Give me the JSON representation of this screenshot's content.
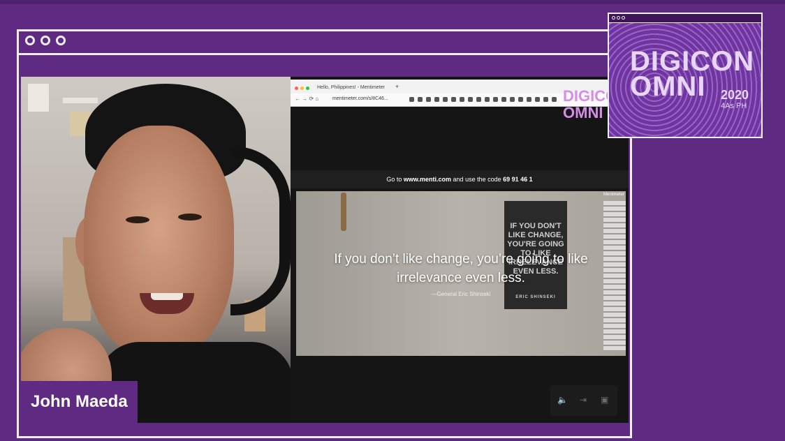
{
  "speaker": {
    "name": "John Maeda"
  },
  "browser": {
    "tab_title": "Hello, Philippines! - Mentimeter",
    "url": "mentimeter.com/s/8C46...",
    "new_tab": "+"
  },
  "menti": {
    "instruction_prefix": "Go to",
    "site": "www.menti.com",
    "instruction_mid": "and use the code",
    "code": "69 91 46 1",
    "logo": "Mentimeter"
  },
  "slide": {
    "quote_line1": "If you don’t like change, you’re going to like",
    "quote_line2": "irrelevance even less.",
    "author": "—General Eric Shinseki",
    "poster_text": "IF YOU DON'T LIKE CHANGE, YOU'RE GOING TO LIKE IRRELEVANCE EVEN LESS.",
    "poster_author": "ERIC SHINSEKI"
  },
  "event": {
    "line1": "DIGICON",
    "line2": "OMNI",
    "year": "2020",
    "org": "4As PH"
  },
  "icons": [
    "volume-icon",
    "exit-icon",
    "pip-icon"
  ],
  "colors": {
    "brand_purple": "#5e2a82",
    "accent": "#d58de6"
  }
}
